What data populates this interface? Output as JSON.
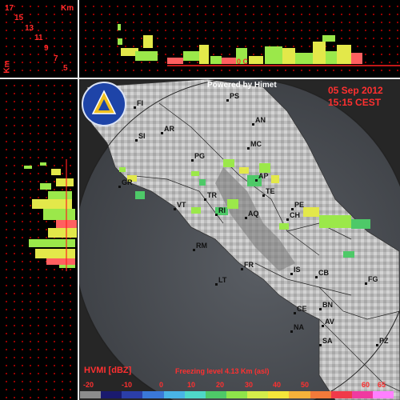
{
  "radar": {
    "powered_by": "Powered by Himet",
    "date": "05 Sep 2012",
    "time": "15:15 CEST",
    "product": "HVMI [dBZ]",
    "freezing_level": "Freezing level  4.13 Km (asl)",
    "freezing_marker": "0 C"
  },
  "height_axis": {
    "unit": "Km",
    "unit_vertical": "Km",
    "ticks": [
      "17",
      "15",
      "13",
      "11",
      "9",
      "7",
      "5"
    ]
  },
  "color_scale": {
    "labels": [
      "-20",
      "-10",
      "0",
      "10",
      "20",
      "30",
      "40",
      "50",
      "60",
      "65"
    ],
    "colors": [
      "#8c8c8c",
      "#1a1a6e",
      "#2b3ea8",
      "#3a78d8",
      "#49b4e6",
      "#4fd8c8",
      "#4ec968",
      "#8ee44a",
      "#d4ec4a",
      "#f5e63a",
      "#f5b23a",
      "#f27a3a",
      "#f03a4a",
      "#f03aa0",
      "#ff80ff"
    ]
  },
  "cities": [
    {
      "name": "PS"
    },
    {
      "name": "FI"
    },
    {
      "name": "AN"
    },
    {
      "name": "AR"
    },
    {
      "name": "SI"
    },
    {
      "name": "MC"
    },
    {
      "name": "PG"
    },
    {
      "name": "AP"
    },
    {
      "name": "GR"
    },
    {
      "name": "TE"
    },
    {
      "name": "TR"
    },
    {
      "name": "VT"
    },
    {
      "name": "RI"
    },
    {
      "name": "PE"
    },
    {
      "name": "AQ"
    },
    {
      "name": "CH"
    },
    {
      "name": "RM"
    },
    {
      "name": "FR"
    },
    {
      "name": "IS"
    },
    {
      "name": "CB"
    },
    {
      "name": "FG"
    },
    {
      "name": "LT"
    },
    {
      "name": "CE"
    },
    {
      "name": "BN"
    },
    {
      "name": "NA"
    },
    {
      "name": "AV"
    },
    {
      "name": "SA"
    },
    {
      "name": "PZ"
    }
  ]
}
